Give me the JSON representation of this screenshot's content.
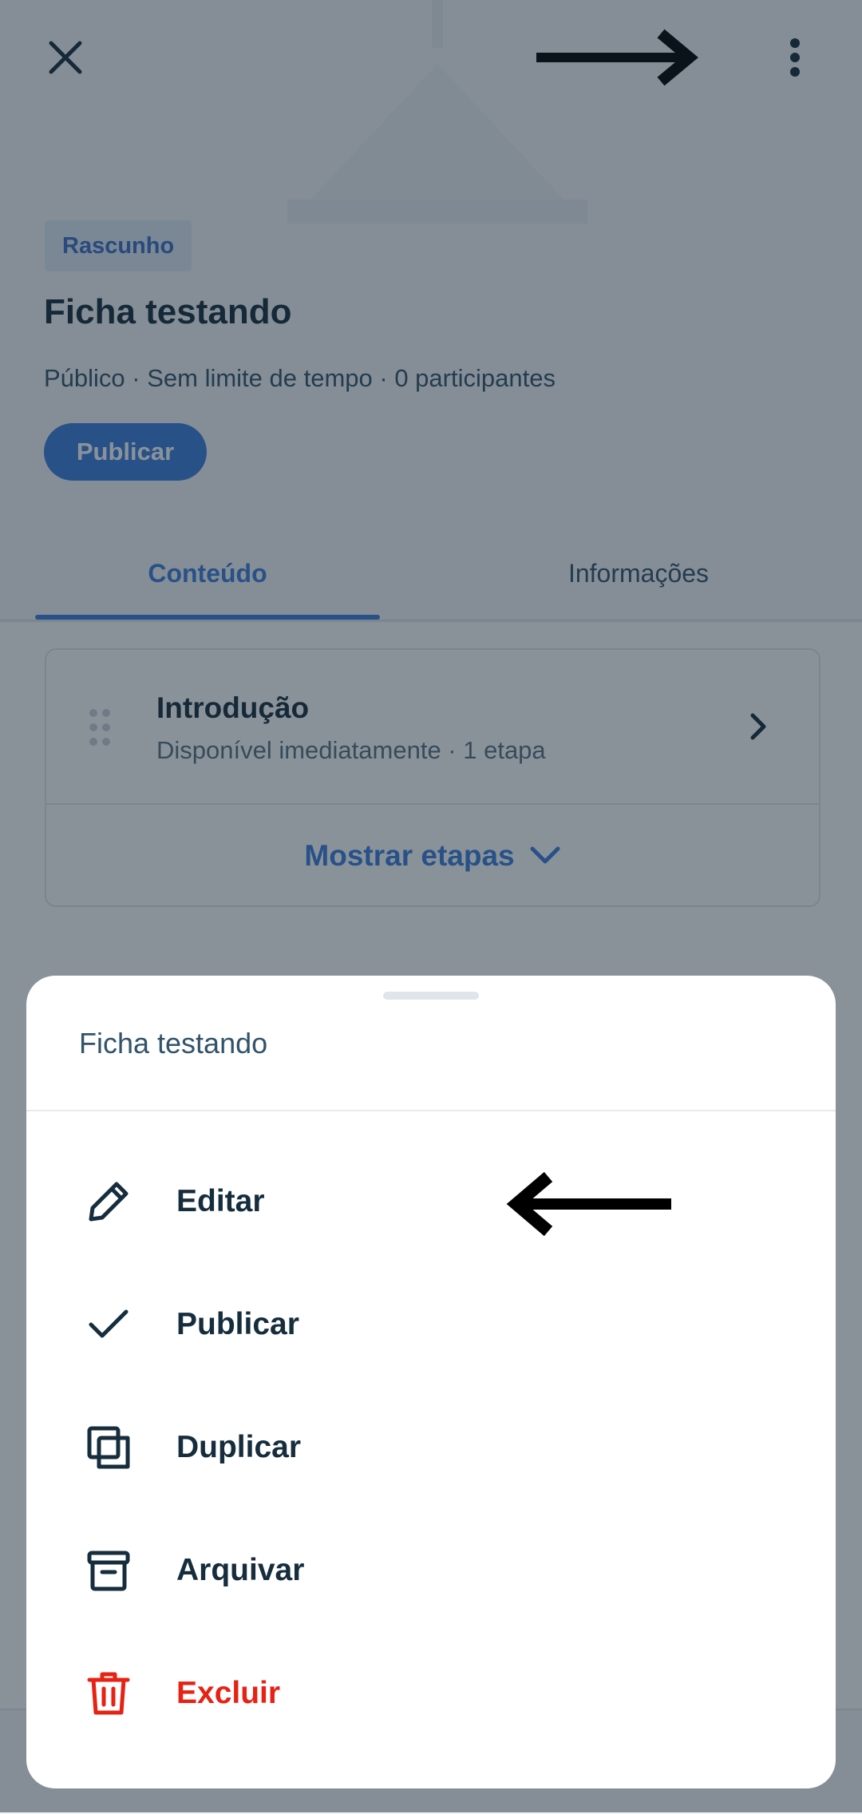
{
  "header": {
    "close_icon": "close-icon",
    "more_icon": "more-vertical-icon"
  },
  "status_badge": "Rascunho",
  "program": {
    "title": "Ficha testando",
    "meta": "Público · Sem limite de tempo · 0 participantes",
    "publish_button": "Publicar"
  },
  "tabs": [
    {
      "label": "Conteúdo",
      "active": true
    },
    {
      "label": "Informações",
      "active": false
    }
  ],
  "section": {
    "title": "Introdução",
    "subtitle": "Disponível imediatamente · 1 etapa",
    "show_steps": "Mostrar etapas"
  },
  "sheet": {
    "title": "Ficha testando",
    "items": [
      {
        "label": "Editar",
        "icon": "pencil-icon"
      },
      {
        "label": "Publicar",
        "icon": "check-icon"
      },
      {
        "label": "Duplicar",
        "icon": "duplicate-icon"
      },
      {
        "label": "Arquivar",
        "icon": "archive-icon"
      },
      {
        "label": "Excluir",
        "icon": "trash-icon",
        "danger": true
      }
    ]
  },
  "colors": {
    "accent": "#3b7ddd",
    "text_primary": "#162d3d",
    "danger": "#e62214",
    "overlay": "rgba(22,37,52,0.5)"
  }
}
